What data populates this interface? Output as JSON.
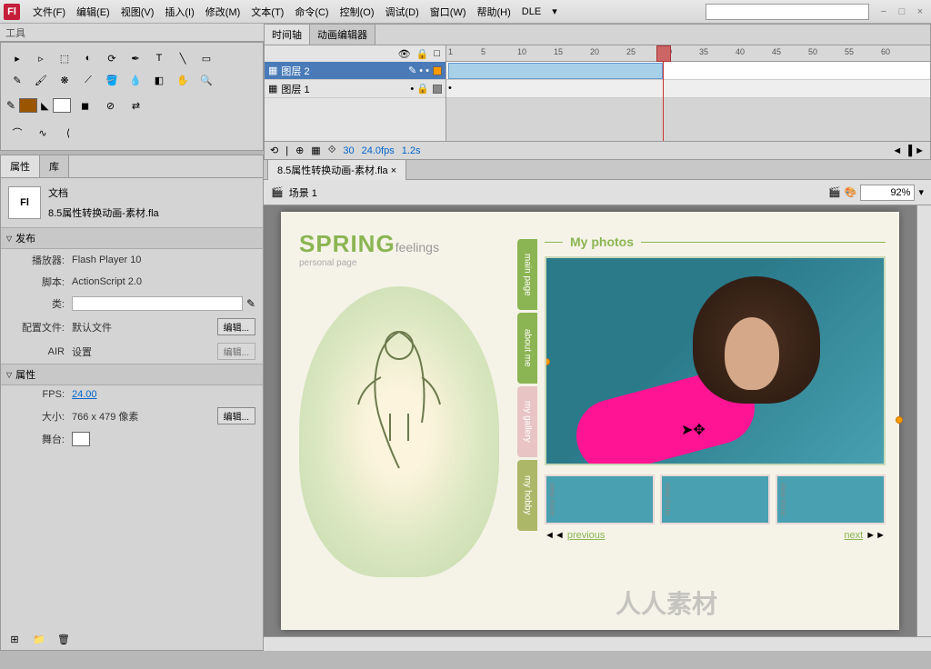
{
  "menu": [
    "文件(F)",
    "编辑(E)",
    "视图(V)",
    "插入(I)",
    "修改(M)",
    "文本(T)",
    "命令(C)",
    "控制(O)",
    "调试(D)",
    "窗口(W)",
    "帮助(H)",
    "DLE"
  ],
  "toolsPanelTitle": "工具",
  "propsPanel": {
    "tab1": "属性",
    "tab2": "库",
    "docLabel": "文档",
    "docName": "8.5属性转换动画-素材.fla",
    "sectionPublish": "发布",
    "player": "Flash Player 10",
    "playerLabel": "播放器:",
    "scriptLabel": "脚本:",
    "script": "ActionScript 2.0",
    "classLabel": "类:",
    "profileLabel": "配置文件:",
    "profile": "默认文件",
    "airLabel": "AIR",
    "airValue": "设置",
    "sectionProps": "属性",
    "fpsLabel": "FPS:",
    "fpsValue": "24.00",
    "sizeLabel": "大小:",
    "sizeValue": "766 x 479 像素",
    "stageLabel": "舞台:",
    "editBtn": "编辑..."
  },
  "timeline": {
    "tab1": "时间轴",
    "tab2": "动画编辑器",
    "layer1": "图层 2",
    "layer2": "图层 1",
    "ticks": [
      1,
      5,
      10,
      15,
      20,
      25,
      30,
      35,
      40,
      45,
      50,
      55,
      60
    ],
    "footerFrame": "30",
    "footerFps": "24.0fps",
    "footerTime": "1.2s"
  },
  "docTab": "8.5属性转换动画-素材.fla",
  "sceneBar": {
    "icon": "🎬",
    "label": "场景 1",
    "zoom": "92%"
  },
  "stage": {
    "logoMain": "SPRING",
    "logoSub": "feelings",
    "logoTagline": "personal page",
    "nav": [
      "main page",
      "about me",
      "my gallery",
      "my hobby"
    ],
    "contentTitle": "My photos",
    "thumbLabel": "view more",
    "prev": "previous",
    "prevArrow": "◄◄",
    "next": "next",
    "nextArrow": "►►"
  },
  "watermark": "人人素材"
}
